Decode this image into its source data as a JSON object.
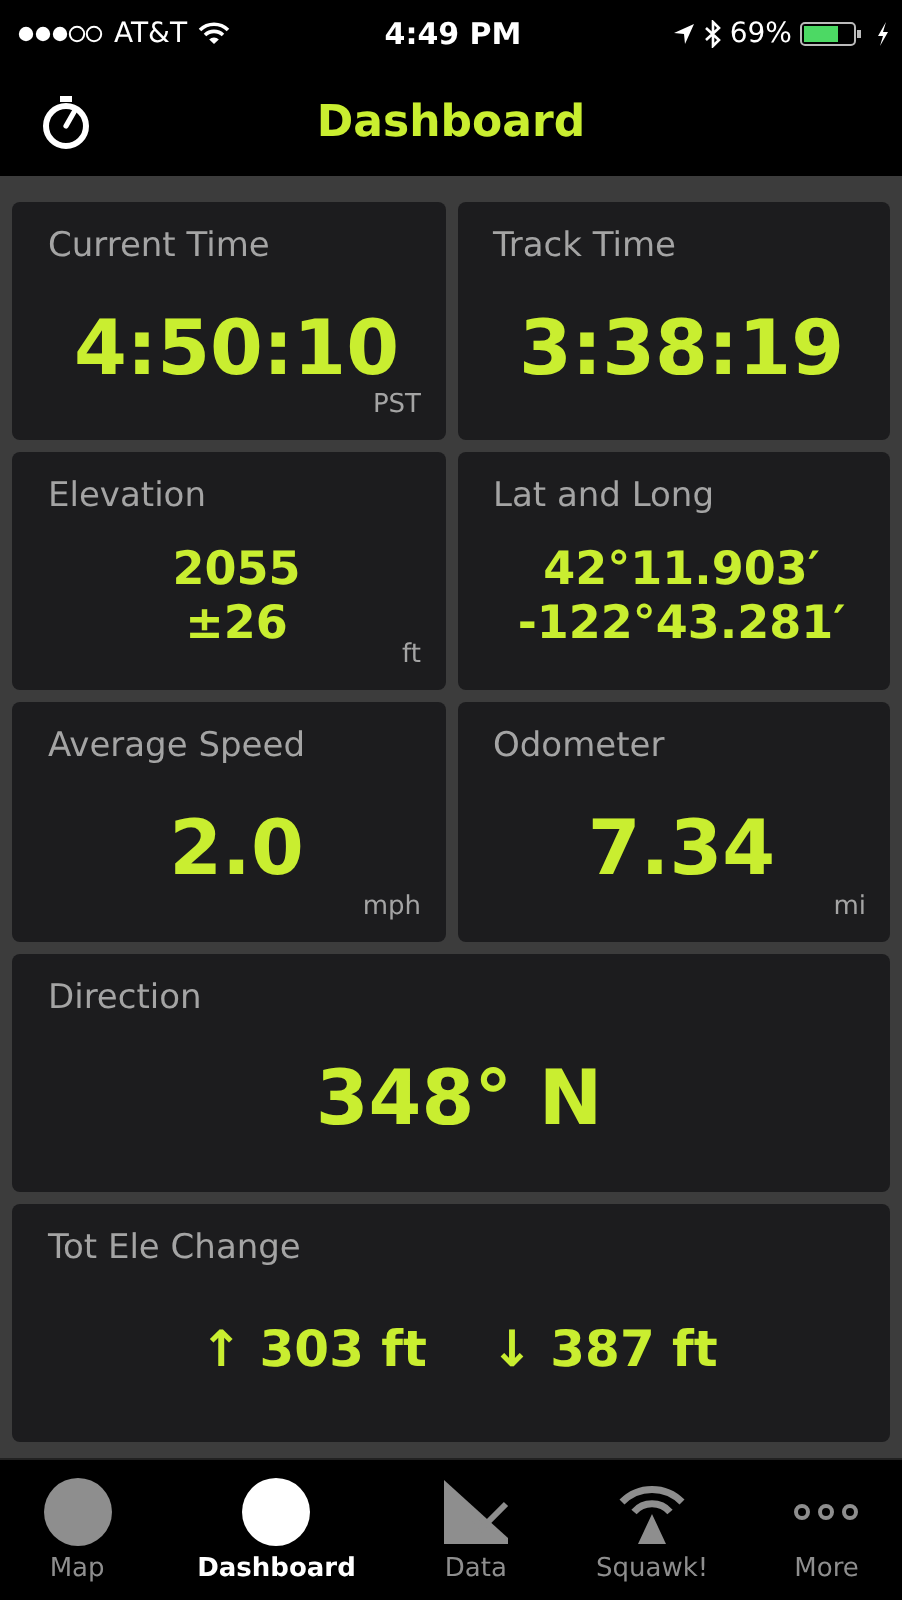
{
  "status_bar": {
    "carrier": "AT&T",
    "time": "4:49 PM",
    "battery": "69%"
  },
  "header": {
    "title": "Dashboard"
  },
  "tiles": [
    {
      "label": "Current Time",
      "kind": "large",
      "values": [
        "4:50:10"
      ],
      "unit": "PST"
    },
    {
      "label": "Track Time",
      "kind": "large",
      "values": [
        "3:38:19"
      ]
    },
    {
      "label": "Elevation",
      "kind": "stacked",
      "values": [
        "2055",
        "±26"
      ],
      "unit": "ft"
    },
    {
      "label": "Lat and Long",
      "kind": "stacked",
      "values": [
        "42°11.903′",
        "-122°43.281′"
      ]
    },
    {
      "label": "Average Speed",
      "kind": "large",
      "values": [
        "2.0"
      ],
      "unit": "mph"
    },
    {
      "label": "Odometer",
      "kind": "large",
      "values": [
        "7.34"
      ],
      "unit": "mi"
    },
    {
      "label": "Direction",
      "kind": "wide",
      "values": [
        "348° N"
      ]
    },
    {
      "label": "Tot Ele Change",
      "kind": "change",
      "values": [
        "↑ 303 ft",
        "↓ 387 ft"
      ]
    }
  ],
  "tab_bar": [
    {
      "label": "Map",
      "selected": false
    },
    {
      "label": "Dashboard",
      "selected": true
    },
    {
      "label": "Data",
      "selected": false
    },
    {
      "label": "Squawk!",
      "selected": false
    },
    {
      "label": "More",
      "selected": false
    }
  ]
}
